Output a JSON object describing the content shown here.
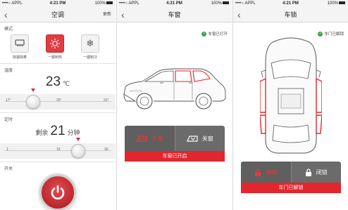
{
  "status": {
    "carrier": "••••○ APPL",
    "time": "4:21 PM",
    "battery": "100%"
  },
  "ac": {
    "title": "空调",
    "right": "更新",
    "mode_label": "模式",
    "modes": [
      {
        "label": "除霜除雾",
        "icon": "defrost-icon",
        "active": false
      },
      {
        "label": "一键制热",
        "icon": "sun-icon",
        "active": true
      },
      {
        "label": "一键制冷",
        "icon": "snowflake-icon",
        "active": false
      }
    ],
    "temp_label": "温度",
    "temp_value": "23",
    "temp_unit": "℃",
    "temp_ticks": [
      "17°",
      "25°",
      "31°"
    ],
    "temp_setpoint": 23,
    "timer_label": "定时",
    "timer_prefix": "剩余",
    "timer_value": "21",
    "timer_unit": "分钟",
    "timer_ticks": [
      "1",
      "15",
      "30"
    ],
    "switch_label": "开关"
  },
  "window": {
    "title": "车窗",
    "state_tag": "车窗已打开",
    "open_label": "开窗",
    "close_label": "关窗",
    "status_bar": "车窗已开启"
  },
  "lock": {
    "title": "车锁",
    "state_tag": "车门已解锁",
    "unlock_label": "解锁",
    "lock_label": "闭锁",
    "status_bar": "车门已解锁"
  },
  "colors": {
    "accent": "#e3262d",
    "dark": "#6b6b6b",
    "ok": "#3aa34a"
  }
}
